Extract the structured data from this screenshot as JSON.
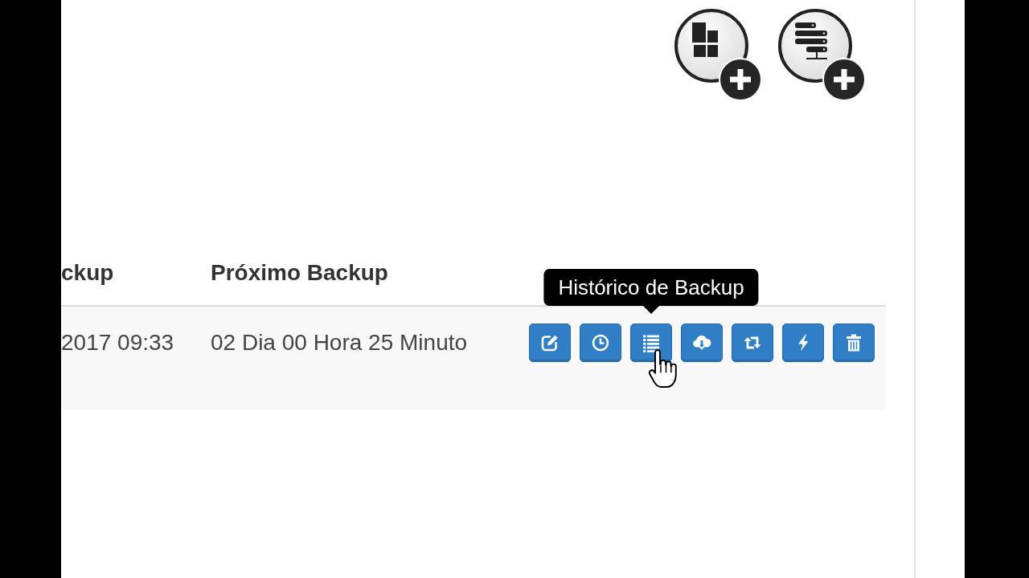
{
  "toolbar": [
    {
      "kind": "add_group"
    },
    {
      "kind": "add_server"
    }
  ],
  "table": {
    "columns": [
      "ckup",
      "Próximo Backup"
    ],
    "rows": [
      {
        "cells": [
          "2017 09:33",
          "02 Dia 00 Hora 25 Minuto"
        ],
        "actions": [
          {
            "kind": "edit"
          },
          {
            "kind": "schedule"
          },
          {
            "kind": "history",
            "tooltip": "Histórico de Backup"
          },
          {
            "kind": "download"
          },
          {
            "kind": "sync"
          },
          {
            "kind": "run"
          },
          {
            "kind": "delete"
          }
        ]
      }
    ]
  }
}
